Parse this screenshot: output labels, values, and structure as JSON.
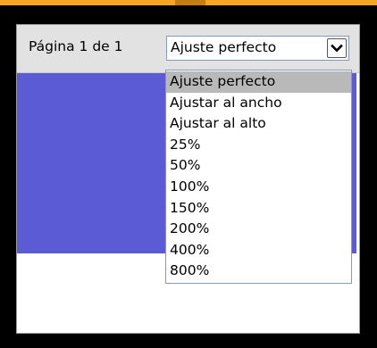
{
  "page_indicator": {
    "label": "Página 1 de 1"
  },
  "zoom_select": {
    "selected_value": "Ajuste perfecto",
    "arrow_icon": "chevron-down-icon",
    "options": [
      "Ajuste perfecto",
      "Ajustar al ancho",
      "Ajustar al alto",
      "25%",
      "50%",
      "100%",
      "150%",
      "200%",
      "400%",
      "800%"
    ],
    "highlighted_index": 0
  },
  "colors": {
    "accent": "#f5a623",
    "page_area": "#5b5bd6",
    "highlight": "#b9b9b9"
  }
}
